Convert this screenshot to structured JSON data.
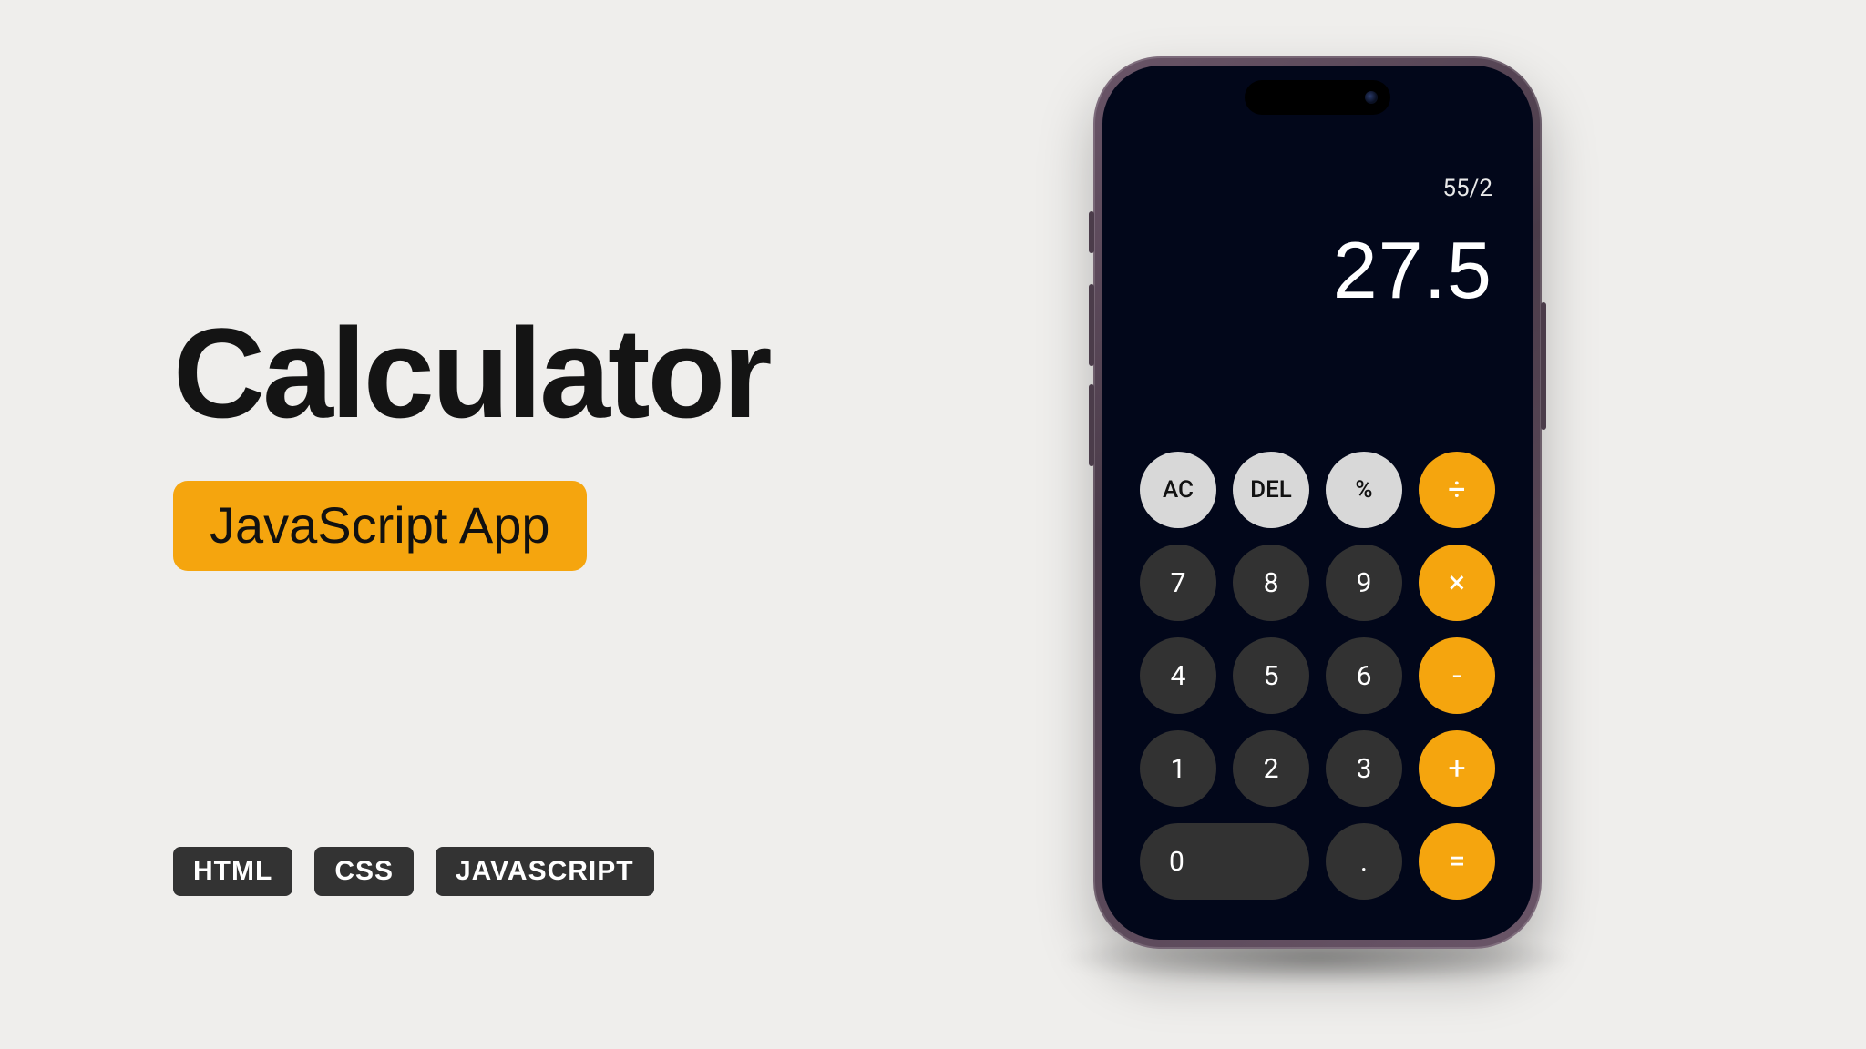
{
  "hero": {
    "title": "Calculator",
    "subtitle": "JavaScript App"
  },
  "tags": [
    "HTML",
    "CSS",
    "JAVASCRIPT"
  ],
  "calc": {
    "expression": "55/2",
    "result": "27.5",
    "keys": {
      "ac": "AC",
      "del": "DEL",
      "percent": "%",
      "divide": "÷",
      "seven": "7",
      "eight": "8",
      "nine": "9",
      "multiply": "×",
      "four": "4",
      "five": "5",
      "six": "6",
      "minus": "-",
      "one": "1",
      "two": "2",
      "three": "3",
      "plus": "+",
      "zero": "0",
      "dot": ".",
      "equals": "="
    }
  },
  "colors": {
    "accent": "#f5a50e",
    "page_bg": "#efeeec",
    "phone_bg": "#02071a",
    "key_num": "#323232",
    "key_fn": "#d8d8d8",
    "tag_bg": "#333333"
  }
}
